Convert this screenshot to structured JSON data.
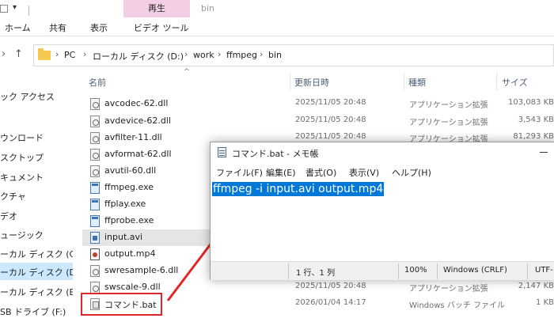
{
  "ribbon": {
    "title": "bin",
    "context_header": "再生",
    "tabs": [
      {
        "label": "ホーム"
      },
      {
        "label": "共有"
      },
      {
        "label": "表示"
      },
      {
        "label": "ビデオ ツール"
      }
    ]
  },
  "address_bar": {
    "back_icon": "back-arrow-icon",
    "forward_icon": "forward-arrow-icon",
    "up_icon": "up-arrow-icon",
    "crumbs": [
      {
        "label": "PC"
      },
      {
        "label": "ローカル ディスク (D:)"
      },
      {
        "label": "work"
      },
      {
        "label": "ffmpeg"
      },
      {
        "label": "bin"
      }
    ],
    "separator": "›"
  },
  "sidebar": {
    "items": [
      {
        "label": "ック アクセス"
      },
      {
        "label": ""
      },
      {
        "label": "ウンロード"
      },
      {
        "label": "スクトップ"
      },
      {
        "label": "キュメント"
      },
      {
        "label": "クチャ"
      },
      {
        "label": "デオ"
      },
      {
        "label": "ュージック"
      },
      {
        "label": "ーカル ディスク (C:)"
      },
      {
        "label": "ーカル ディスク (D:)"
      },
      {
        "label": "ーカル ディスク (E:)"
      },
      {
        "label": "SB ドライブ (F:)"
      }
    ]
  },
  "file_list": {
    "columns": {
      "name": "名前",
      "date": "更新日時",
      "type": "種類",
      "size": "サイズ"
    },
    "rows": [
      {
        "name": "avcodec-62.dll",
        "date": "2025/11/05 20:48",
        "type": "アプリケーション拡張",
        "size": "103,083 KB"
      },
      {
        "name": "avdevice-62.dll",
        "date": "2025/11/05 20:48",
        "type": "アプリケーション拡張",
        "size": "3,543 KB"
      },
      {
        "name": "avfilter-11.dll",
        "date": "2025/11/05 20:48",
        "type": "アプリケーション拡張",
        "size": "81,293 KB"
      },
      {
        "name": "avformat-62.dll",
        "date": "",
        "type": "",
        "size": ""
      },
      {
        "name": "avutil-60.dll",
        "date": "",
        "type": "",
        "size": ""
      },
      {
        "name": "ffmpeg.exe",
        "date": "",
        "type": "",
        "size": ""
      },
      {
        "name": "ffplay.exe",
        "date": "",
        "type": "",
        "size": ""
      },
      {
        "name": "ffprobe.exe",
        "date": "",
        "type": "",
        "size": ""
      },
      {
        "name": "input.avi",
        "date": "",
        "type": "",
        "size": ""
      },
      {
        "name": "output.mp4",
        "date": "",
        "type": "",
        "size": ""
      },
      {
        "name": "swresample-6.dll",
        "date": "",
        "type": "",
        "size": ""
      },
      {
        "name": "swscale-9.dll",
        "date": "2025/11/05 20:48",
        "type": "アプリケーション拡張",
        "size": "2,147 KB"
      },
      {
        "name": "コマンド.bat",
        "date": "2026/01/04 14:17",
        "type": "Windows バッチ ファイル",
        "size": "1 KB"
      }
    ]
  },
  "notepad": {
    "title": "コマンド.bat - メモ帳",
    "menu": [
      {
        "label": "ファイル(F)"
      },
      {
        "label": "編集(E)"
      },
      {
        "label": "書式(O)"
      },
      {
        "label": "表示(V)"
      },
      {
        "label": "ヘルプ(H)"
      }
    ],
    "content": "ffmpeg -i input.avi output.mp4",
    "status": {
      "position": "1 行、1 列",
      "zoom": "100%",
      "line_ending": "Windows (CRLF)",
      "encoding": "UTF-"
    }
  },
  "colors": {
    "selection": "#0078d7",
    "highlight_box": "#e02626",
    "arrow": "#e02626",
    "context_tab": "#f2cfe4"
  }
}
